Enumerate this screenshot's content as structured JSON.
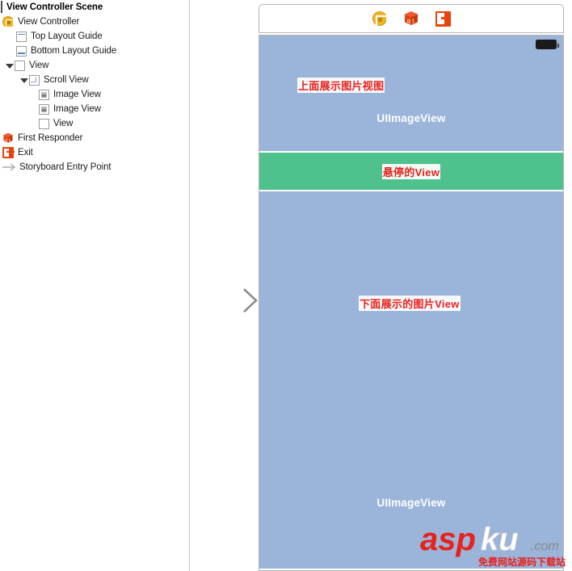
{
  "outline": {
    "scene_title": "View Controller Scene",
    "items": [
      {
        "label": "View Controller",
        "icon": "view-controller-icon",
        "indent": 0,
        "twisty": "none"
      },
      {
        "label": "Top Layout Guide",
        "icon": "top-layout-guide-icon",
        "indent": 1,
        "twisty": "none"
      },
      {
        "label": "Bottom Layout Guide",
        "icon": "bottom-layout-guide-icon",
        "indent": 1,
        "twisty": "none"
      },
      {
        "label": "View",
        "icon": "view-icon",
        "indent": 2,
        "twisty": "open"
      },
      {
        "label": "Scroll View",
        "icon": "scroll-view-icon",
        "indent": 3,
        "twisty": "open"
      },
      {
        "label": "Image View",
        "icon": "image-view-icon",
        "indent": 4,
        "twisty": "none"
      },
      {
        "label": "Image View",
        "icon": "image-view-icon",
        "indent": 4,
        "twisty": "none"
      },
      {
        "label": "View",
        "icon": "view-icon",
        "indent": 4,
        "twisty": "none"
      },
      {
        "label": "First Responder",
        "icon": "first-responder-icon",
        "indent": 0,
        "twisty": "none"
      },
      {
        "label": "Exit",
        "icon": "exit-icon",
        "indent": 0,
        "twisty": "none"
      },
      {
        "label": "Storyboard Entry Point",
        "icon": "storyboard-entry-arrow-icon",
        "indent": 0,
        "twisty": "none"
      }
    ]
  },
  "canvas": {
    "toolbar": {
      "icons": [
        {
          "name": "view-controller-icon",
          "title": "View Controller"
        },
        {
          "name": "first-responder-icon",
          "title": "First Responder"
        },
        {
          "name": "exit-icon",
          "title": "Exit"
        }
      ]
    },
    "top_image_view": {
      "annotation": "上面展示图片视图",
      "placeholder": "UIImageView"
    },
    "floating_view": {
      "annotation": "悬停的View"
    },
    "bottom_image_view": {
      "annotation": "下面展示的图片View",
      "placeholder": "UIImageView"
    }
  },
  "colors": {
    "image_view_blue": "#9ab4da",
    "floating_view_green": "#4ec18c",
    "annotation_red": "#e8211b",
    "view_controller_yellow": "#f0b323",
    "exit_orange": "#e8430f"
  },
  "watermark": {
    "brand_part1": "asp",
    "brand_part2": "ku",
    "domain": ".com",
    "tagline": "免费网站源码下载站"
  }
}
